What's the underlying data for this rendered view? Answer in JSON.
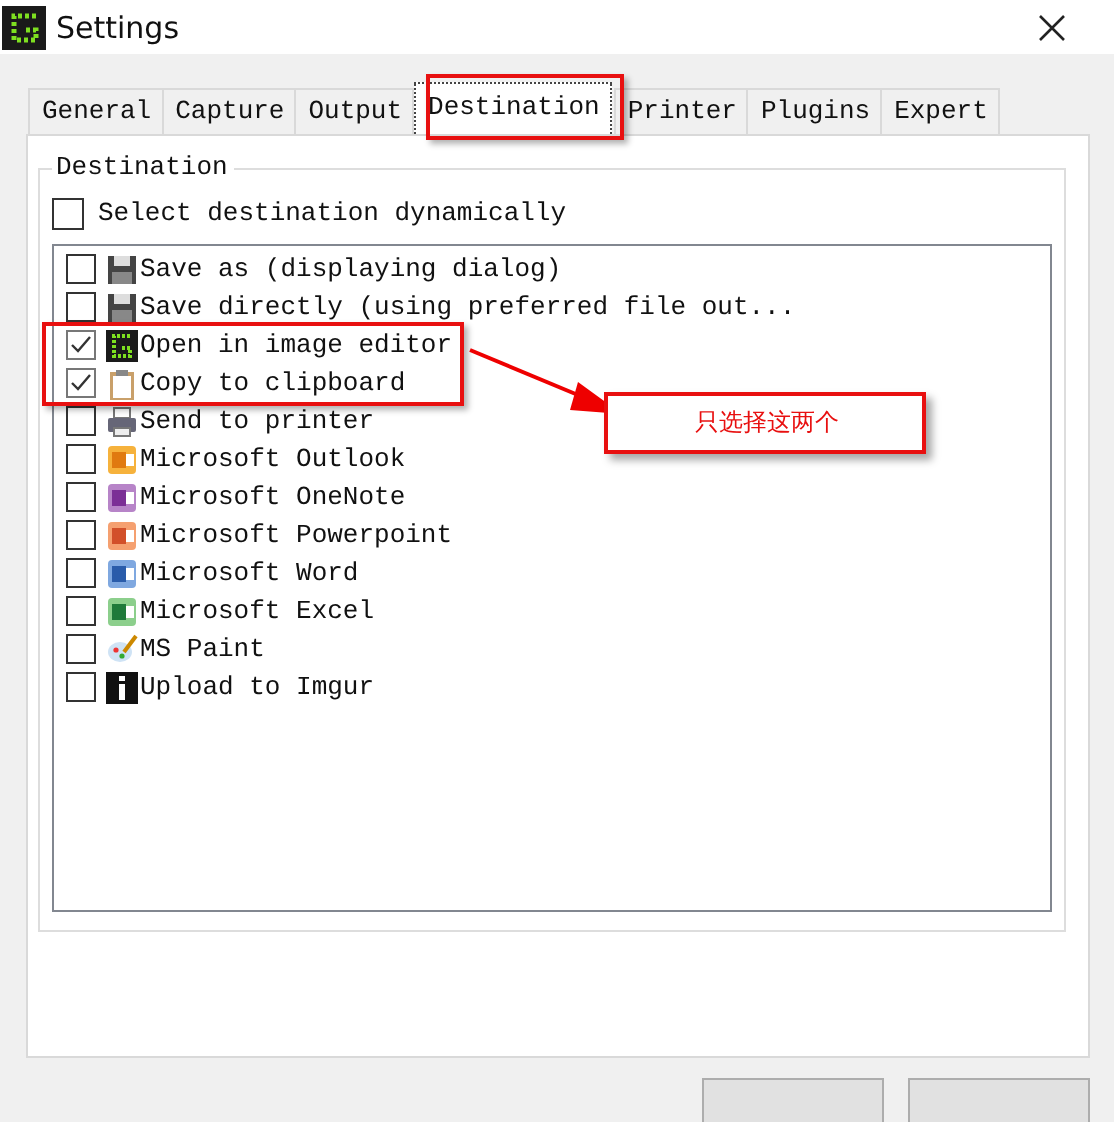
{
  "window": {
    "title": "Settings"
  },
  "tabs": [
    {
      "label": "General",
      "selected": false
    },
    {
      "label": "Capture",
      "selected": false
    },
    {
      "label": "Output",
      "selected": false
    },
    {
      "label": "Destination",
      "selected": true
    },
    {
      "label": "Printer",
      "selected": false
    },
    {
      "label": "Plugins",
      "selected": false
    },
    {
      "label": "Expert",
      "selected": false
    }
  ],
  "group": {
    "title": "Destination",
    "dynamic": {
      "label": "Select destination dynamically",
      "checked": false
    }
  },
  "destinations": [
    {
      "label": "Save as (displaying dialog)",
      "checked": false,
      "kind": "floppy"
    },
    {
      "label": "Save directly (using preferred file out...",
      "checked": false,
      "kind": "floppy"
    },
    {
      "label": "Open in image editor",
      "checked": true,
      "kind": "editor"
    },
    {
      "label": "Copy to clipboard",
      "checked": true,
      "kind": "clipboard"
    },
    {
      "label": "Send to printer",
      "checked": false,
      "kind": "printer"
    },
    {
      "label": "Microsoft Outlook",
      "checked": false,
      "kind": "outlook"
    },
    {
      "label": "Microsoft OneNote",
      "checked": false,
      "kind": "onenote"
    },
    {
      "label": "Microsoft Powerpoint",
      "checked": false,
      "kind": "powerpoint"
    },
    {
      "label": "Microsoft Word",
      "checked": false,
      "kind": "word"
    },
    {
      "label": "Microsoft Excel",
      "checked": false,
      "kind": "excel"
    },
    {
      "label": "MS Paint",
      "checked": false,
      "kind": "paint"
    },
    {
      "label": "Upload to Imgur",
      "checked": false,
      "kind": "imgur"
    }
  ],
  "annotation": {
    "text": "只选择这两个"
  }
}
